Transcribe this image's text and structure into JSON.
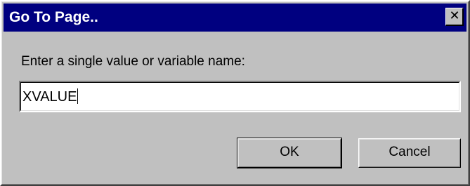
{
  "dialog": {
    "title": "Go To Page..",
    "close_icon": "close-icon",
    "prompt": "Enter a single value or variable name:",
    "input": {
      "value": "XVALUE",
      "placeholder": ""
    },
    "buttons": {
      "ok_label": "OK",
      "cancel_label": "Cancel"
    }
  },
  "colors": {
    "title_bar": "#000080",
    "title_text": "#ffffff",
    "face": "#c0c0c0",
    "input_bg": "#ffffff"
  }
}
